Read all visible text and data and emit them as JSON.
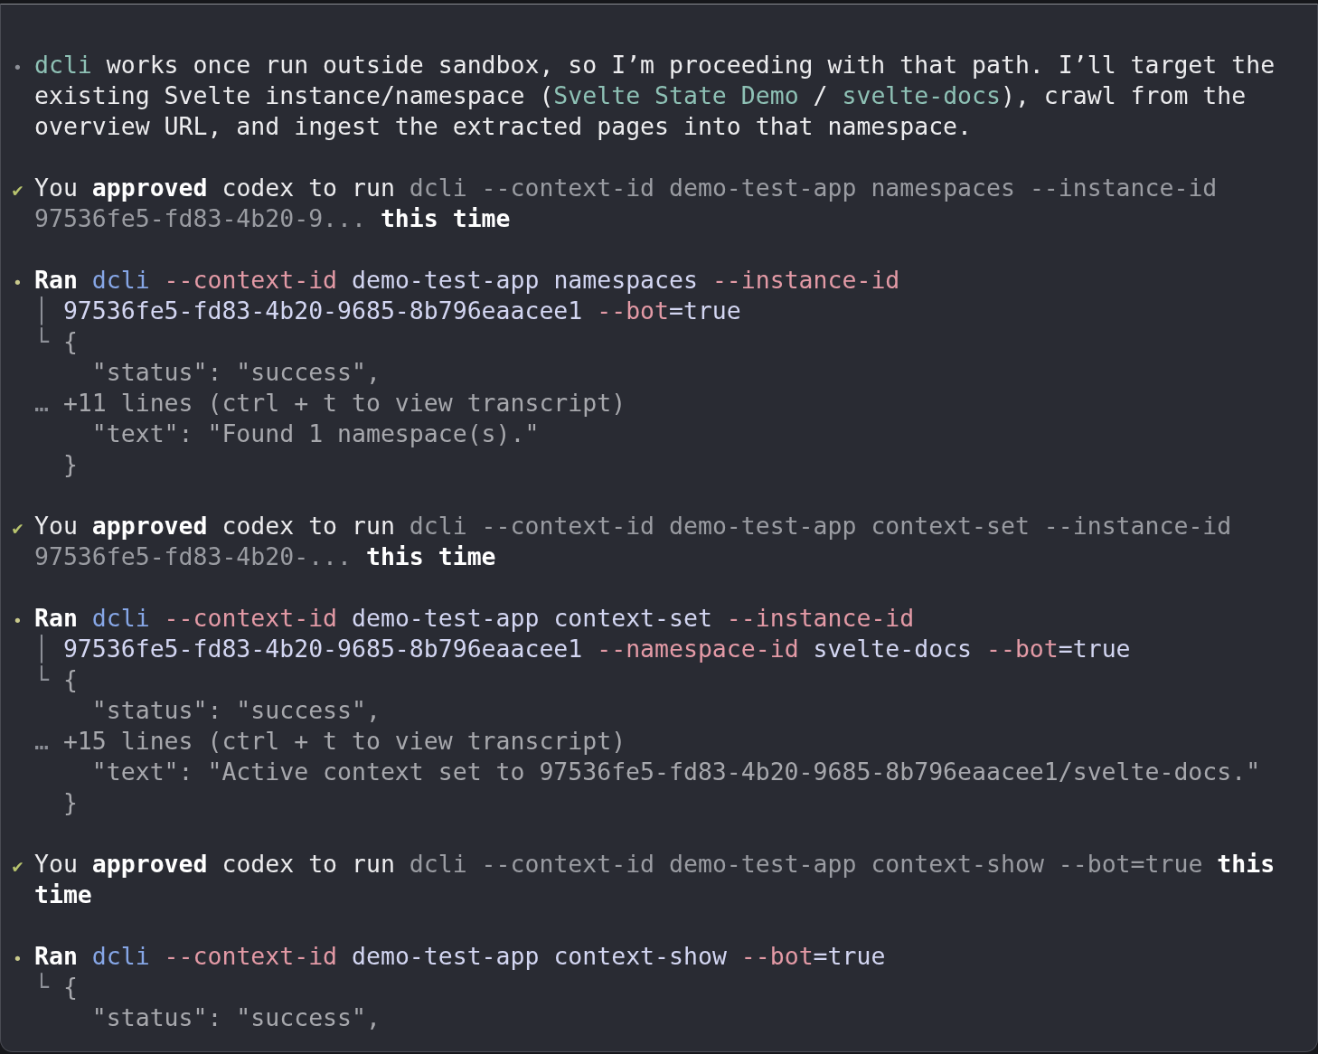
{
  "blocks": [
    {
      "lines": [
        {
          "kind": "head",
          "gutter": {
            "text": "•",
            "kind": "muted"
          },
          "segments": [
            {
              "text": "dcli",
              "kind": "accent"
            },
            {
              "text": " works once run outside sandbox, so I’m proceeding with that path. I’ll target the",
              "kind": "plain"
            }
          ]
        },
        {
          "kind": "wrap",
          "segments": [
            {
              "text": "existing Svelte instance/namespace (",
              "kind": "plain"
            },
            {
              "text": "Svelte State Demo",
              "kind": "accent"
            },
            {
              "text": " / ",
              "kind": "plain"
            },
            {
              "text": "svelte-docs",
              "kind": "accent"
            },
            {
              "text": "), crawl from the",
              "kind": "plain"
            }
          ]
        },
        {
          "kind": "wrap",
          "segments": [
            {
              "text": "overview URL, and ingest the extracted pages into that namespace.",
              "kind": "plain"
            }
          ]
        }
      ]
    },
    {
      "lines": [
        {
          "kind": "head",
          "gutter": {
            "text": "✔",
            "kind": "success"
          },
          "segments": [
            {
              "text": "You ",
              "kind": "plain"
            },
            {
              "text": "approved",
              "kind": "strong"
            },
            {
              "text": " codex to run ",
              "kind": "plain"
            },
            {
              "text": "dcli --context-id demo-test-app namespaces --instance-id",
              "kind": "dim"
            }
          ]
        },
        {
          "kind": "wrap",
          "segments": [
            {
              "text": "97536fe5-fd83-4b20-9... ",
              "kind": "dim"
            },
            {
              "text": "this time",
              "kind": "strong"
            }
          ]
        }
      ]
    },
    {
      "lines": [
        {
          "kind": "head",
          "gutter": {
            "text": "•",
            "kind": "ran"
          },
          "segments": [
            {
              "text": "Ran ",
              "kind": "strong"
            },
            {
              "text": "dcli",
              "kind": "command"
            },
            {
              "text": " --context-id",
              "kind": "flag"
            },
            {
              "text": " demo-test-app namespaces",
              "kind": "arg"
            },
            {
              "text": " --instance-id",
              "kind": "flag"
            }
          ]
        },
        {
          "kind": "body",
          "prefix": "│",
          "segments": [
            {
              "text": "97536fe5-fd83-4b20-9685-8b796eaacee1",
              "kind": "arg"
            },
            {
              "text": " --bot",
              "kind": "flag"
            },
            {
              "text": "=true",
              "kind": "arg"
            }
          ]
        },
        {
          "kind": "body",
          "prefix": "└",
          "segments": [
            {
              "text": "{",
              "kind": "output"
            }
          ]
        },
        {
          "kind": "nested",
          "segments": [
            {
              "text": "\"status\": \"success\",",
              "kind": "output"
            }
          ]
        },
        {
          "kind": "body",
          "prefix": "…",
          "segments": [
            {
              "text": "+11 lines (ctrl + t to view transcript)",
              "kind": "output"
            }
          ]
        },
        {
          "kind": "nested",
          "segments": [
            {
              "text": "\"text\": \"Found 1 namespace(s).\"",
              "kind": "output"
            }
          ]
        },
        {
          "kind": "body",
          "segments": [
            {
              "text": "}",
              "kind": "output"
            }
          ]
        }
      ]
    },
    {
      "lines": [
        {
          "kind": "head",
          "gutter": {
            "text": "✔",
            "kind": "success"
          },
          "segments": [
            {
              "text": "You ",
              "kind": "plain"
            },
            {
              "text": "approved",
              "kind": "strong"
            },
            {
              "text": " codex to run ",
              "kind": "plain"
            },
            {
              "text": "dcli --context-id demo-test-app context-set --instance-id",
              "kind": "dim"
            }
          ]
        },
        {
          "kind": "wrap",
          "segments": [
            {
              "text": "97536fe5-fd83-4b20-... ",
              "kind": "dim"
            },
            {
              "text": "this time",
              "kind": "strong"
            }
          ]
        }
      ]
    },
    {
      "lines": [
        {
          "kind": "head",
          "gutter": {
            "text": "•",
            "kind": "ran"
          },
          "segments": [
            {
              "text": "Ran ",
              "kind": "strong"
            },
            {
              "text": "dcli",
              "kind": "command"
            },
            {
              "text": " --context-id",
              "kind": "flag"
            },
            {
              "text": " demo-test-app context-set",
              "kind": "arg"
            },
            {
              "text": " --instance-id",
              "kind": "flag"
            }
          ]
        },
        {
          "kind": "body",
          "prefix": "│",
          "segments": [
            {
              "text": "97536fe5-fd83-4b20-9685-8b796eaacee1",
              "kind": "arg"
            },
            {
              "text": " --namespace-id",
              "kind": "flag"
            },
            {
              "text": " svelte-docs",
              "kind": "arg"
            },
            {
              "text": " --bot",
              "kind": "flag"
            },
            {
              "text": "=true",
              "kind": "arg"
            }
          ]
        },
        {
          "kind": "body",
          "prefix": "└",
          "segments": [
            {
              "text": "{",
              "kind": "output"
            }
          ]
        },
        {
          "kind": "nested",
          "segments": [
            {
              "text": "\"status\": \"success\",",
              "kind": "output"
            }
          ]
        },
        {
          "kind": "body",
          "prefix": "…",
          "segments": [
            {
              "text": "+15 lines (ctrl + t to view transcript)",
              "kind": "output"
            }
          ]
        },
        {
          "kind": "nested",
          "segments": [
            {
              "text": "\"text\": \"Active context set to 97536fe5-fd83-4b20-9685-8b796eaacee1/svelte-docs.\"",
              "kind": "output"
            }
          ]
        },
        {
          "kind": "body",
          "segments": [
            {
              "text": "}",
              "kind": "output"
            }
          ]
        }
      ]
    },
    {
      "lines": [
        {
          "kind": "head",
          "gutter": {
            "text": "✔",
            "kind": "success"
          },
          "segments": [
            {
              "text": "You ",
              "kind": "plain"
            },
            {
              "text": "approved",
              "kind": "strong"
            },
            {
              "text": " codex to run ",
              "kind": "plain"
            },
            {
              "text": "dcli --context-id demo-test-app context-show --bot=true",
              "kind": "dim"
            },
            {
              "text": " this",
              "kind": "strong"
            }
          ]
        },
        {
          "kind": "wrap",
          "segments": [
            {
              "text": "time",
              "kind": "strong"
            }
          ]
        }
      ]
    },
    {
      "lines": [
        {
          "kind": "head",
          "gutter": {
            "text": "•",
            "kind": "ran"
          },
          "segments": [
            {
              "text": "Ran ",
              "kind": "strong"
            },
            {
              "text": "dcli",
              "kind": "command"
            },
            {
              "text": " --context-id",
              "kind": "flag"
            },
            {
              "text": " demo-test-app context-show",
              "kind": "arg"
            },
            {
              "text": " --bot",
              "kind": "flag"
            },
            {
              "text": "=true",
              "kind": "arg"
            }
          ]
        },
        {
          "kind": "body",
          "prefix": "└",
          "segments": [
            {
              "text": "{",
              "kind": "output"
            }
          ]
        },
        {
          "kind": "nested",
          "segments": [
            {
              "text": "\"status\": \"success\",",
              "kind": "output"
            }
          ]
        }
      ]
    }
  ]
}
